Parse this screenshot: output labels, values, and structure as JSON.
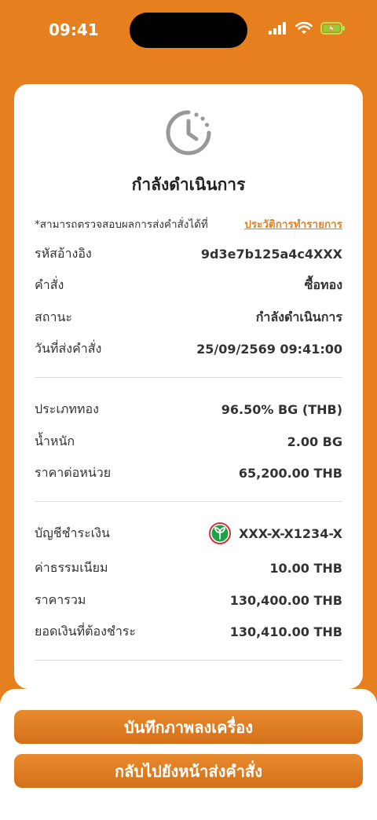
{
  "status_bar": {
    "time": "09:41"
  },
  "status": {
    "title": "กำลังดำเนินการ"
  },
  "note": {
    "text": "*สามารถตรวจสอบผลการส่งคำสั่งได้ที่",
    "link": "ประวัติการทำรายการ"
  },
  "section1": [
    {
      "label": "รหัสอ้างอิง",
      "value": "9d3e7b125a4c4XXX"
    },
    {
      "label": "คำสั่ง",
      "value": "ซื้อทอง"
    },
    {
      "label": "สถานะ",
      "value": "กำลังดำเนินการ"
    },
    {
      "label": "วันที่ส่งคำสั่ง",
      "value": "25/09/2569 09:41:00"
    }
  ],
  "section2": [
    {
      "label": "ประเภททอง",
      "value": "96.50% BG (THB)"
    },
    {
      "label": "น้ำหนัก",
      "value": "2.00 BG"
    },
    {
      "label": "ราคาต่อหน่วย",
      "value": "65,200.00 THB"
    }
  ],
  "section3": {
    "account": {
      "label": "บัญชีชำระเงิน",
      "value": "XXX-X-X1234-X",
      "bank_icon": "kasikorn-bank-logo"
    },
    "rows": [
      {
        "label": "ค่าธรรมเนียม",
        "value": "10.00 THB"
      },
      {
        "label": "ราคารวม",
        "value": "130,400.00 THB"
      },
      {
        "label": "ยอดเงินที่ต้องชำระ",
        "value": "130,410.00 THB"
      }
    ]
  },
  "buttons": {
    "save_image": "บันทึกภาพลงเครื่อง",
    "back_to_order": "กลับไปยังหน้าส่งคำสั่ง"
  },
  "colors": {
    "accent": "#E6801F",
    "bank_green": "#1BA345",
    "bank_red": "#D4212A"
  }
}
